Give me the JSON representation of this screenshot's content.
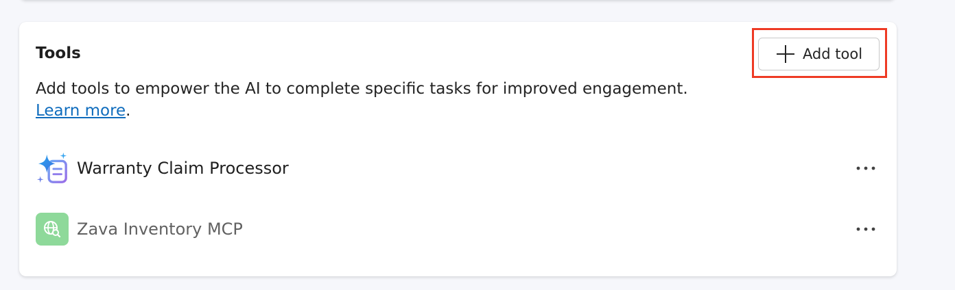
{
  "tools_section": {
    "title": "Tools",
    "add_tool_label": "Add tool",
    "description": "Add tools to empower the AI to complete specific tasks for improved engagement.",
    "learn_more": "Learn more",
    "learn_more_suffix": ".",
    "items": [
      {
        "name": "Warranty Claim Processor",
        "icon": "sparkle-form-icon",
        "more": "more-options-icon"
      },
      {
        "name": "Zava Inventory MCP",
        "icon": "globe-search-icon",
        "more": "more-options-icon"
      }
    ]
  },
  "colors": {
    "highlight": "#ee3a24",
    "link": "#0f6cbd",
    "mcp_icon_bg": "#8ed99a"
  }
}
